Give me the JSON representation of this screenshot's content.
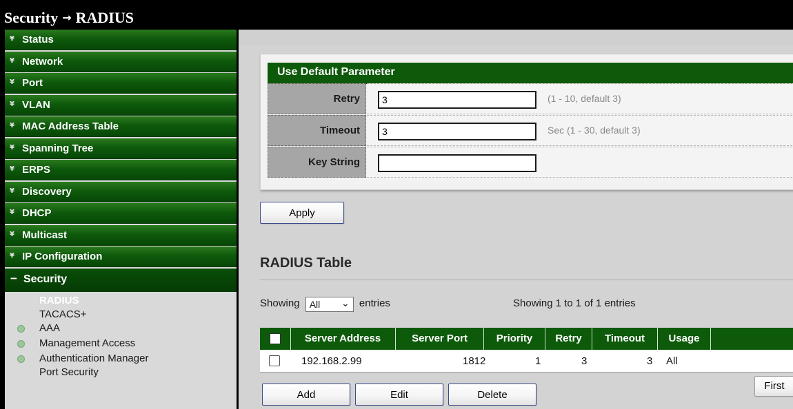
{
  "breadcrumb": {
    "section": "Security",
    "separator": "→",
    "page": "RADIUS"
  },
  "sidebar": {
    "items": [
      {
        "label": "Status"
      },
      {
        "label": "Network"
      },
      {
        "label": "Port"
      },
      {
        "label": "VLAN"
      },
      {
        "label": "MAC Address Table"
      },
      {
        "label": "Spanning Tree"
      },
      {
        "label": "ERPS"
      },
      {
        "label": "Discovery"
      },
      {
        "label": "DHCP"
      },
      {
        "label": "Multicast"
      },
      {
        "label": "IP Configuration"
      }
    ],
    "open": {
      "label": "Security",
      "expander": "−",
      "children": [
        {
          "label": "RADIUS"
        },
        {
          "label": "TACACS+"
        },
        {
          "label": "AAA"
        },
        {
          "label": "Management Access"
        },
        {
          "label": "Authentication Manager"
        },
        {
          "label": "Port Security"
        }
      ]
    }
  },
  "params": {
    "title": "Use Default Parameter",
    "retry": {
      "label": "Retry",
      "value": "3",
      "hint": "(1 - 10, default 3)"
    },
    "timeout": {
      "label": "Timeout",
      "value": "3",
      "hint": "Sec (1 - 30, default 3)"
    },
    "key": {
      "label": "Key String",
      "value": ""
    },
    "apply_label": "Apply"
  },
  "radius_table": {
    "title": "RADIUS Table",
    "showing_prefix": "Showing",
    "entries_select": "All",
    "entries_suffix": "entries",
    "summary": "Showing 1 to 1 of 1 entries",
    "columns": [
      "Server Address",
      "Server Port",
      "Priority",
      "Retry",
      "Timeout",
      "Usage"
    ],
    "rows": [
      {
        "server_address": "192.168.2.99",
        "server_port": "1812",
        "priority": "1",
        "retry": "3",
        "timeout": "3",
        "usage": "All"
      }
    ],
    "buttons": {
      "add": "Add",
      "edit": "Edit",
      "delete": "Delete",
      "first": "First"
    }
  },
  "colors": {
    "header_green": "#0d5a0a",
    "menu_green": "#0e5a0c",
    "panel_gray": "#d3d3d3"
  }
}
